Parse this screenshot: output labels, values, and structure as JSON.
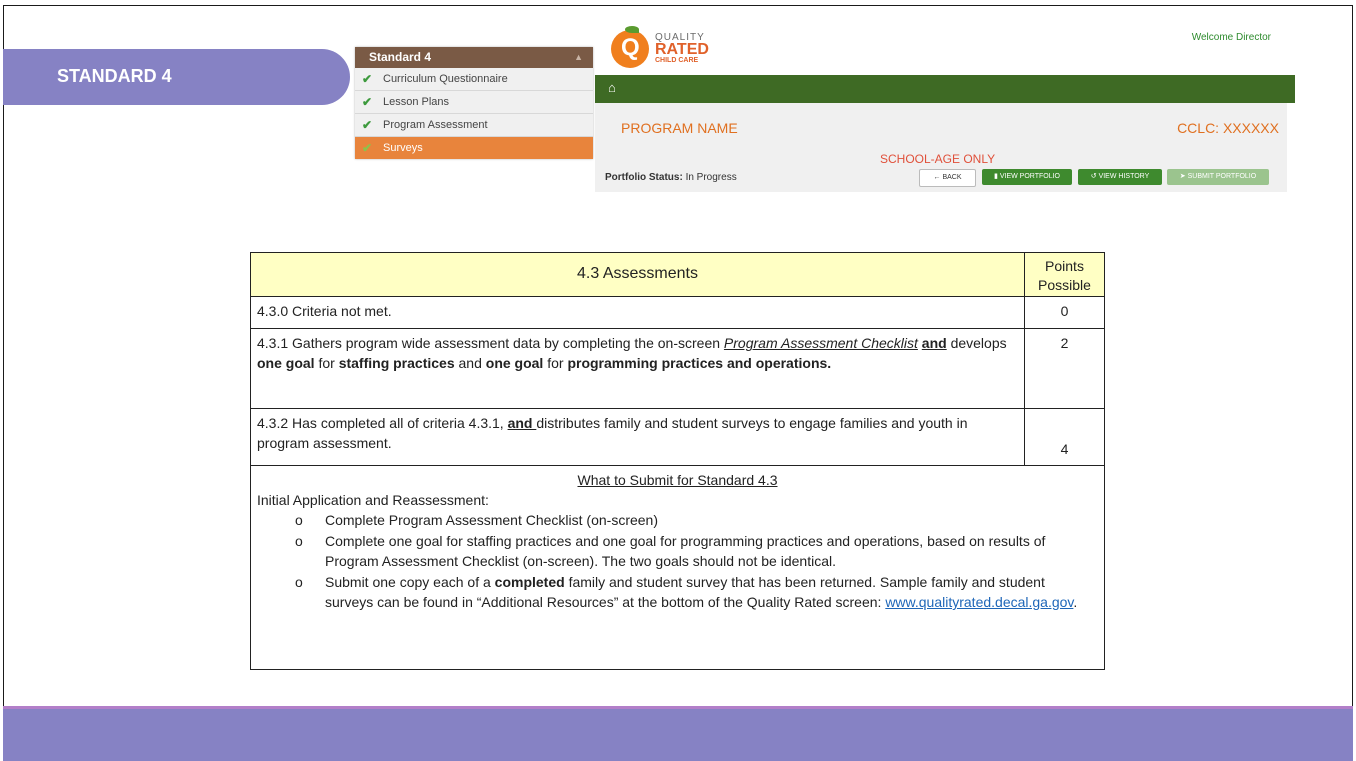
{
  "slide": {
    "standard_tab": "STANDARD 4"
  },
  "standard_menu": {
    "header": "Standard 4",
    "caret": "▲",
    "items": [
      {
        "label": "Curriculum Questionnaire",
        "checked": true
      },
      {
        "label": "Lesson Plans",
        "checked": true
      },
      {
        "label": "Program Assessment",
        "checked": true
      },
      {
        "label": "Surveys",
        "checked": true,
        "active": true
      }
    ]
  },
  "qr_app": {
    "logo": {
      "line1": "QUALITY",
      "line2": "RATED",
      "line3": "CHILD CARE",
      "letter": "Q"
    },
    "welcome": "Welcome Director",
    "nav_icon": "home-icon",
    "program_name": "PROGRAM NAME",
    "cclc": "CCLC: XXXXXX",
    "school_age": "SCHOOL-AGE ONLY",
    "status_label": "Portfolio Status:",
    "status_value": "In Progress",
    "buttons": {
      "back": "BACK",
      "view_portfolio": "VIEW PORTFOLIO",
      "view_history": "VIEW HISTORY",
      "submit_portfolio": "SUBMIT PORTFOLIO"
    },
    "colors": {
      "nav_green": "#3e6a24",
      "accent_orange": "#e07020"
    }
  },
  "criteria_table": {
    "title": "4.3 Assessments",
    "points_header_line1": "Points",
    "points_header_line2": "Possible",
    "rows": [
      {
        "text": "4.3.0 Criteria not met.",
        "points": "0"
      },
      {
        "t1": "4.3.1 Gathers program wide assessment data by completing the on-screen ",
        "t2": "Program Assessment Checklist",
        "t3": " ",
        "t4": "and",
        "t5": " develops ",
        "t6": "one goal",
        "t7": " for ",
        "t8": "staffing practices",
        "t9": " and ",
        "t10": "one goal",
        "t11": " for ",
        "t12": "programming practices and operations.",
        "points": "2"
      },
      {
        "t1": "4.3.2 Has completed all of criteria 4.3.1, ",
        "t2": "and ",
        "t3": "distributes family and student surveys to engage families and youth in program assessment.",
        "points": "4"
      }
    ],
    "submit": {
      "title": "What to Submit for Standard 4.3",
      "intro": "Initial Application and Reassessment:",
      "b1": "Complete Program Assessment Checklist (on-screen)",
      "b2": "Complete one goal for staffing practices and one goal for programming practices and operations, based on results of Program Assessment Checklist (on-screen). The two goals should not be identical.",
      "b3a": "Submit one copy each of a ",
      "b3b": "completed",
      "b3c": " family and student survey that has been returned. Sample family and student surveys can be found in “Additional Resources” at the bottom of the Quality Rated screen: ",
      "b3link": "www.qualityrated.decal.ga.gov",
      "b3d": "."
    }
  },
  "colors": {
    "band_purple": "#8682c4",
    "table_header_yellow": "#ffffc4"
  }
}
